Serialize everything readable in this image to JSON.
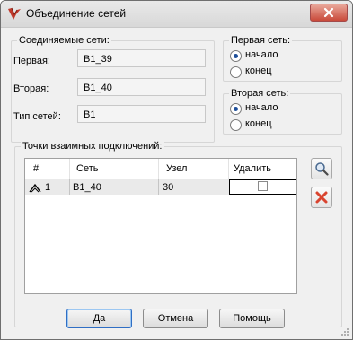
{
  "window": {
    "title": "Объединение сетей"
  },
  "connected_networks": {
    "legend": "Соединяемые сети:",
    "first_label": "Первая:",
    "first_value": "B1_39",
    "second_label": "Вторая:",
    "second_value": "B1_40",
    "type_label": "Тип сетей:",
    "type_value": "B1"
  },
  "first_network": {
    "legend": "Первая сеть:",
    "options": [
      "начало",
      "конец"
    ],
    "selected": "начало"
  },
  "second_network": {
    "legend": "Вторая сеть:",
    "options": [
      "начало",
      "конец"
    ],
    "selected": "начало"
  },
  "connections": {
    "legend": "Точки взаимных подключений:",
    "columns": [
      "#",
      "Сеть",
      "Узел",
      "Удалить"
    ],
    "rows": [
      {
        "num": "1",
        "net": "B1_40",
        "node": "30",
        "delete": false
      }
    ]
  },
  "side_buttons": {
    "find_icon": "magnifier-icon",
    "delete_icon": "red-x-icon"
  },
  "buttons": {
    "ok": "Да",
    "cancel": "Отмена",
    "help": "Помощь"
  },
  "colors": {
    "accent": "#2f6ec4",
    "delete_red": "#d9442f"
  }
}
